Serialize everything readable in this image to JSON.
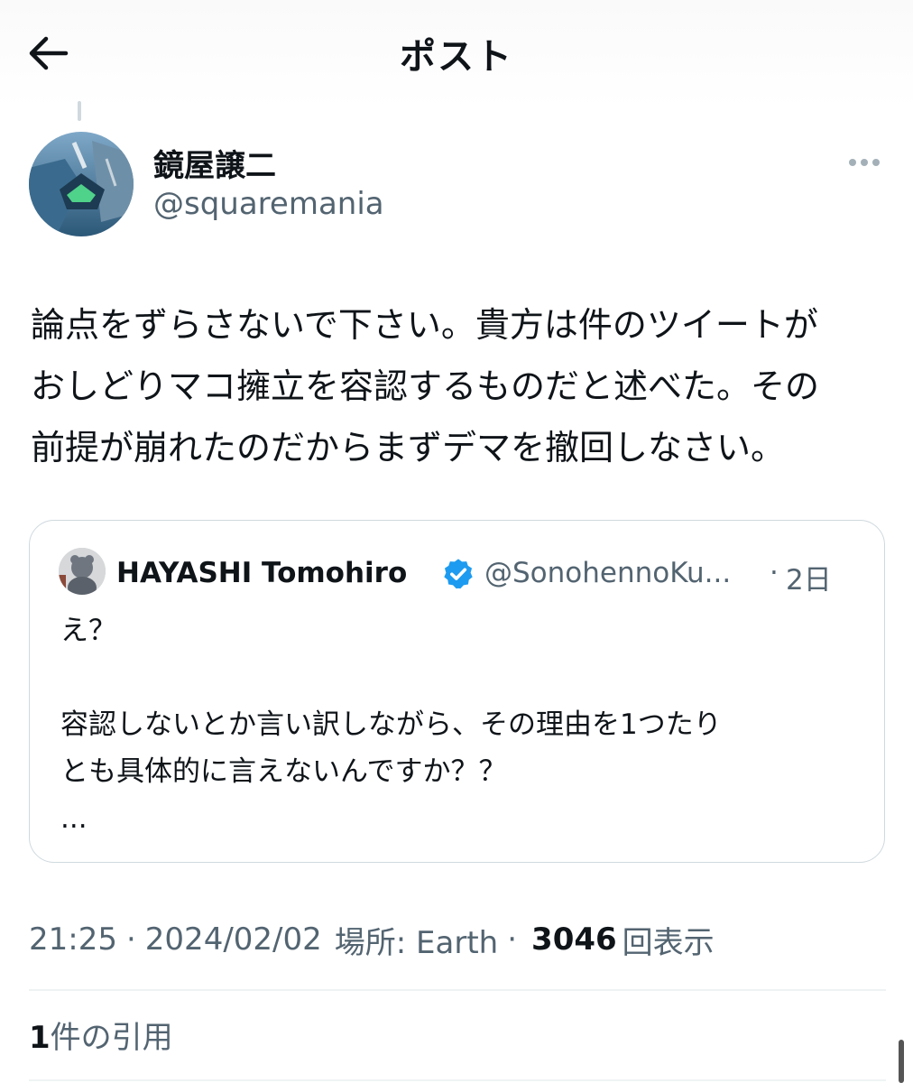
{
  "header": {
    "title": "ポスト",
    "back_icon": "arrow-left-icon"
  },
  "author": {
    "display_name": "鏡屋譲二",
    "handle": "@squaremania",
    "more_icon": "more-horizontal-icon"
  },
  "post": {
    "lines": [
      "論点をずらさないで下さい。貴方は件のツイートが",
      "おしどりマコ擁立を容認するものだと述べた。その",
      "前提が崩れたのだからまずデマを撤回しなさい。"
    ]
  },
  "quoted": {
    "display_name": "HAYASHI Tomohiro",
    "verified_icon": "verified-badge-icon",
    "handle": "@SonohennoKu...",
    "separator": "·",
    "time": "2日",
    "lines": [
      "え？",
      "",
      "容認しないとか言い訳しながら、その理由を1つたり",
      "とも具体的に言えないんですか？？",
      "..."
    ]
  },
  "meta": {
    "time": "21:25",
    "sep1": "·",
    "date": "2024/02/02",
    "location": "場所: Earth",
    "sep2": "·",
    "views": "3046",
    "views_suffix": "回表示"
  },
  "quotes": {
    "count": "1",
    "label": "件の引用"
  },
  "colors": {
    "text": "#0f1419",
    "secondary": "#536471",
    "verified": "#1d9bf0",
    "border": "#cfd9de"
  }
}
